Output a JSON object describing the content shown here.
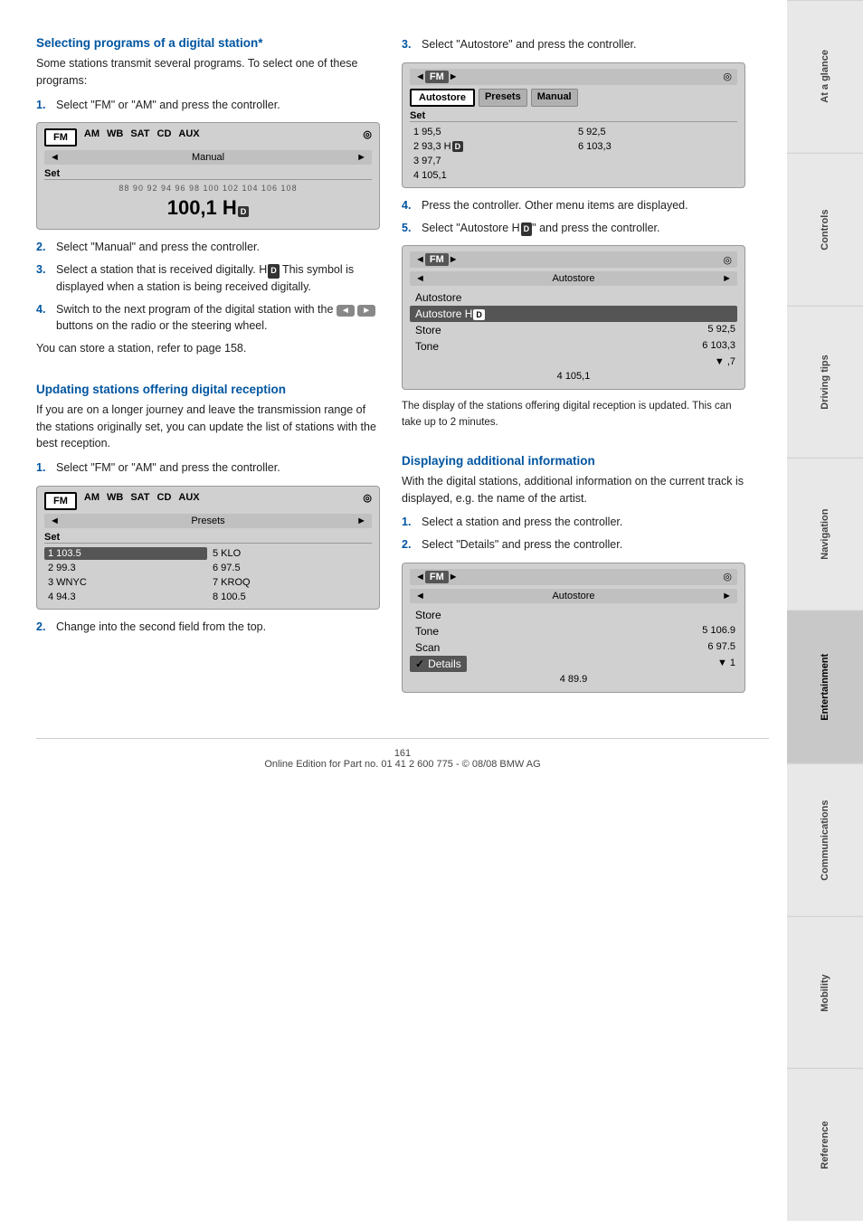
{
  "page": {
    "number": "161",
    "footer": "Online Edition for Part no. 01 41 2 600 775 - © 08/08 BMW AG"
  },
  "sidebar": {
    "tabs": [
      {
        "label": "At a glance",
        "active": false
      },
      {
        "label": "Controls",
        "active": false
      },
      {
        "label": "Driving tips",
        "active": false
      },
      {
        "label": "Navigation",
        "active": false
      },
      {
        "label": "Entertainment",
        "active": true
      },
      {
        "label": "Communications",
        "active": false
      },
      {
        "label": "Mobility",
        "active": false
      },
      {
        "label": "Reference",
        "active": false
      }
    ]
  },
  "section1": {
    "title": "Selecting programs of a digital station*",
    "intro": "Some stations transmit several programs. To select one of these programs:",
    "steps": [
      {
        "num": "1.",
        "text": "Select \"FM\" or \"AM\" and press the controller."
      },
      {
        "num": "2.",
        "text": "Select \"Manual\" and press the controller."
      },
      {
        "num": "3.",
        "text": "Select a station that is received digitally. HD This symbol is displayed when a station is being received digitally."
      },
      {
        "num": "4.",
        "text": "Switch to the next program of the digital station with the ◄ ► buttons on the radio or the steering wheel."
      }
    ],
    "store_note": "You can store a station, refer to page 158.",
    "display1": {
      "source_tabs": [
        "FM",
        "AM",
        "WB",
        "SAT",
        "CD",
        "AUX"
      ],
      "active_tab": "FM",
      "nav_label": "Manual",
      "set_label": "Set",
      "scale": "88  90  92  94  96  98 100 102 104 106 108",
      "freq_large": "100,1 HD"
    }
  },
  "section2": {
    "title": "Updating stations offering digital reception",
    "intro": "If you are on a longer journey and leave the transmission range of the stations originally set, you can update the list of stations with the best reception.",
    "steps": [
      {
        "num": "1.",
        "text": "Select \"FM\" or \"AM\" and press the controller."
      },
      {
        "num": "2.",
        "text": "Change into the second field from the top."
      }
    ],
    "display2": {
      "source_tabs": [
        "FM",
        "AM",
        "WB",
        "SAT",
        "CD",
        "AUX"
      ],
      "active_tab": "FM",
      "nav_label": "Presets",
      "set_label": "Set",
      "presets": [
        {
          "pos": "1",
          "val": "103.5",
          "col": 1
        },
        {
          "pos": "5",
          "val": "KLO",
          "col": 2
        },
        {
          "pos": "2",
          "val": "99.3",
          "col": 1
        },
        {
          "pos": "6",
          "val": "97.5",
          "col": 2
        },
        {
          "pos": "3",
          "val": "WNYC",
          "col": 1
        },
        {
          "pos": "7",
          "val": "KROQ",
          "col": 2
        },
        {
          "pos": "4",
          "val": "94.3",
          "col": 1
        },
        {
          "pos": "8",
          "val": "100.5",
          "col": 2
        }
      ]
    }
  },
  "section3": {
    "title_step3": "Select \"Autostore\" and press the controller.",
    "step_num": "3.",
    "display3": {
      "nav_label": "FM",
      "nav_label2": "Autostore",
      "set_label": "Set",
      "menu_items": [
        "Autostore",
        "Presets",
        "Manual"
      ],
      "active_menu": "Autostore",
      "presets": [
        {
          "pos": "1",
          "val": "95,5",
          "col": 1
        },
        {
          "pos": "5",
          "val": "92,5",
          "col": 2
        },
        {
          "pos": "2",
          "val": "93,3 HD",
          "col": 1
        },
        {
          "pos": "6",
          "val": "103,3",
          "col": 2
        },
        {
          "pos": "3",
          "val": "97,7",
          "col": 1
        },
        {
          "pos": "4",
          "val": "105,1",
          "col": 1
        }
      ]
    },
    "step4": {
      "num": "4.",
      "text": "Press the controller. Other menu items are displayed."
    },
    "step5": {
      "num": "5.",
      "text": "Select \"Autostore HD\" and press the controller."
    },
    "display4": {
      "nav_label": "FM",
      "nav_label2": "Autostore",
      "menu_items": [
        "Autostore",
        "Autostore HD",
        "Store",
        "Tone"
      ],
      "active_menu": "Autostore HD",
      "presets": [
        {
          "pos": "5",
          "val": "92,5"
        },
        {
          "pos": "6",
          "val": "103,3"
        },
        {
          "pos": "",
          "val": ",7"
        },
        {
          "pos": "4",
          "val": "105,1"
        }
      ]
    },
    "update_note": "The display of the stations offering digital reception is updated. This can take up to 2 minutes."
  },
  "section4": {
    "title": "Displaying additional information",
    "intro": "With the digital stations, additional information on the current track is displayed, e.g. the name of the artist.",
    "steps": [
      {
        "num": "1.",
        "text": "Select a station and press the controller."
      },
      {
        "num": "2.",
        "text": "Select \"Details\" and press the controller."
      }
    ],
    "display5": {
      "nav_label": "FM",
      "nav_label2": "Autostore",
      "menu_items": [
        "Store",
        "Tone",
        "Scan",
        "Details"
      ],
      "active_menu": "Details",
      "presets": [
        {
          "pos": "5",
          "val": "106.9"
        },
        {
          "pos": "6",
          "val": "97.5"
        },
        {
          "pos": "1",
          "val": ""
        },
        {
          "pos": "4",
          "val": "89.9"
        }
      ]
    }
  }
}
